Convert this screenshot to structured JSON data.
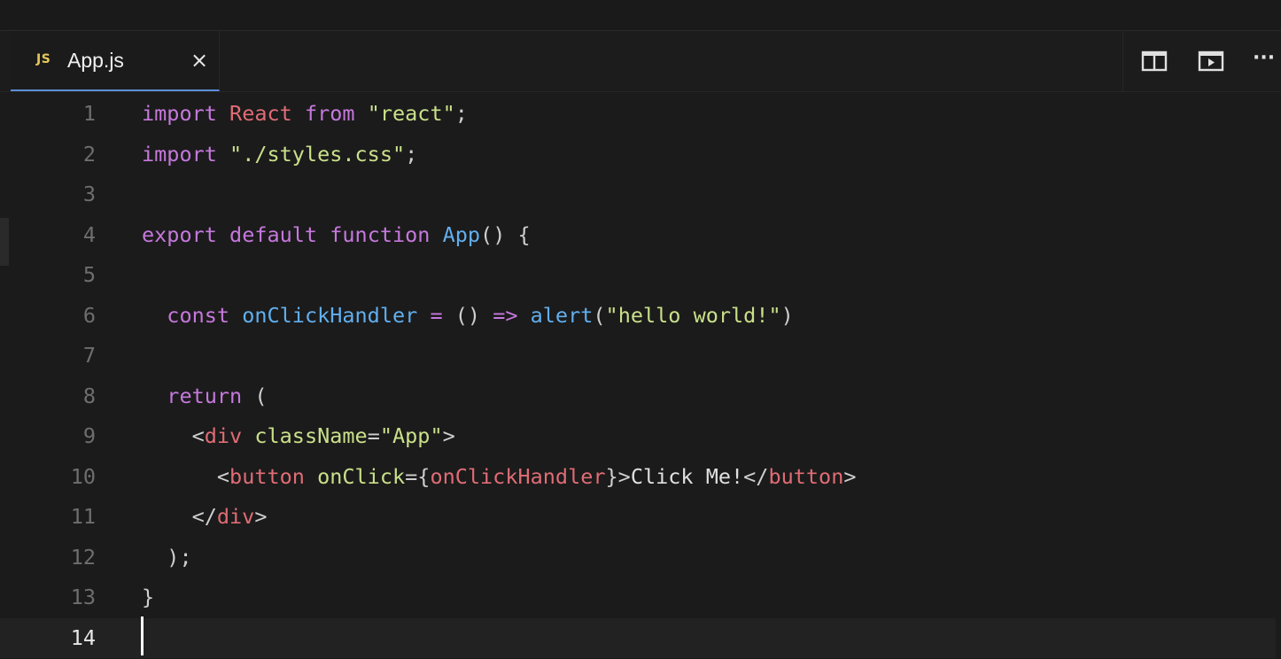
{
  "tab": {
    "badge": "JS",
    "filename": "App.js",
    "close_glyph": "×"
  },
  "toolbar": {
    "split_icon": "split-editor-icon",
    "preview_icon": "open-preview-icon",
    "more_label": "···"
  },
  "editor": {
    "current_line": 14,
    "lines": [
      {
        "n": "1",
        "tokens": [
          [
            "kw",
            "import"
          ],
          [
            "pn",
            " "
          ],
          [
            "id",
            "React"
          ],
          [
            "pn",
            " "
          ],
          [
            "kw",
            "from"
          ],
          [
            "pn",
            " "
          ],
          [
            "str",
            "\"react\""
          ],
          [
            "pn",
            ";"
          ]
        ]
      },
      {
        "n": "2",
        "tokens": [
          [
            "kw",
            "import"
          ],
          [
            "pn",
            " "
          ],
          [
            "str",
            "\"./styles.css\""
          ],
          [
            "pn",
            ";"
          ]
        ]
      },
      {
        "n": "3",
        "tokens": []
      },
      {
        "n": "4",
        "tokens": [
          [
            "kw",
            "export"
          ],
          [
            "pn",
            " "
          ],
          [
            "kw",
            "default"
          ],
          [
            "pn",
            " "
          ],
          [
            "kw",
            "function"
          ],
          [
            "pn",
            " "
          ],
          [
            "fn",
            "App"
          ],
          [
            "pn",
            "() {"
          ]
        ]
      },
      {
        "n": "5",
        "tokens": []
      },
      {
        "n": "6",
        "tokens": [
          [
            "pn",
            "  "
          ],
          [
            "kw",
            "const"
          ],
          [
            "pn",
            " "
          ],
          [
            "fn",
            "onClickHandler"
          ],
          [
            "pn",
            " "
          ],
          [
            "op",
            "="
          ],
          [
            "pn",
            " () "
          ],
          [
            "op",
            "=>"
          ],
          [
            "pn",
            " "
          ],
          [
            "fn",
            "alert"
          ],
          [
            "pn",
            "("
          ],
          [
            "str",
            "\"hello world!\""
          ],
          [
            "pn",
            ")"
          ]
        ]
      },
      {
        "n": "7",
        "tokens": []
      },
      {
        "n": "8",
        "tokens": [
          [
            "pn",
            "  "
          ],
          [
            "kw",
            "return"
          ],
          [
            "pn",
            " ("
          ]
        ]
      },
      {
        "n": "9",
        "tokens": [
          [
            "pn",
            "    <"
          ],
          [
            "id",
            "div"
          ],
          [
            "pn",
            " "
          ],
          [
            "str",
            "className"
          ],
          [
            "pn",
            "="
          ],
          [
            "str",
            "\"App\""
          ],
          [
            "pn",
            ">"
          ]
        ]
      },
      {
        "n": "10",
        "tokens": [
          [
            "pn",
            "      <"
          ],
          [
            "id",
            "button"
          ],
          [
            "pn",
            " "
          ],
          [
            "str",
            "onClick"
          ],
          [
            "pn",
            "={"
          ],
          [
            "id",
            "onClickHandler"
          ],
          [
            "pn",
            "}>"
          ],
          [
            "tx",
            "Click Me!"
          ],
          [
            "pn",
            "</"
          ],
          [
            "id",
            "button"
          ],
          [
            "pn",
            ">"
          ]
        ]
      },
      {
        "n": "11",
        "tokens": [
          [
            "pn",
            "    </"
          ],
          [
            "id",
            "div"
          ],
          [
            "pn",
            ">"
          ]
        ]
      },
      {
        "n": "12",
        "tokens": [
          [
            "pn",
            "  );"
          ]
        ]
      },
      {
        "n": "13",
        "tokens": [
          [
            "pn",
            "}"
          ]
        ]
      },
      {
        "n": "14",
        "tokens": []
      }
    ]
  },
  "colors": {
    "keyword": "#c678dd",
    "identifier": "#e06c75",
    "string": "#c9e08a",
    "function": "#61afef",
    "tab_accent": "#5b8fd6"
  }
}
